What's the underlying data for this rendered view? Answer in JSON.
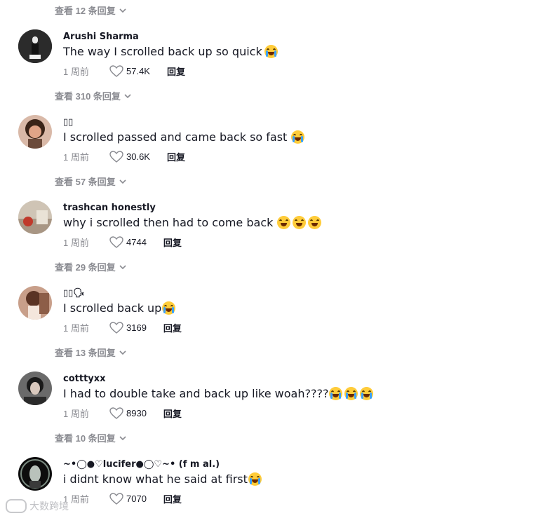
{
  "view_more": [
    {
      "label": "查看 12 条回复"
    },
    {
      "label": "查看 310 条回复"
    },
    {
      "label": "查看 57 条回复"
    },
    {
      "label": "查看 29 条回复"
    },
    {
      "label": "查看 13 条回复"
    },
    {
      "label": "查看 10 条回复"
    }
  ],
  "comments": [
    {
      "username": "Arushi Sharma",
      "text": "The way I scrolled back up so quick",
      "emoji": "crying-face",
      "time": "1 周前",
      "likes": "57.4K",
      "reply": "回复"
    },
    {
      "username": "▯▯",
      "text": "I scrolled passed and came back so fast",
      "emoji": "crying-face",
      "time": "1 周前",
      "likes": "30.6K",
      "reply": "回复"
    },
    {
      "username": "trashcan honestly",
      "text": "why i scrolled then had to come back",
      "emoji": "grinning-face x3",
      "time": "1 周前",
      "likes": "4744",
      "reply": "回复"
    },
    {
      "username": "▯▯🗣",
      "text": "I scrolled back up",
      "emoji": "crying-face",
      "time": "1 周前",
      "likes": "3169",
      "reply": "回复"
    },
    {
      "username": "cotttyxx",
      "text": "I had to double take and back up like woah????",
      "emoji": "crying-face x3",
      "time": "1 周前",
      "likes": "8930",
      "reply": "回复"
    },
    {
      "username": "~•◯●♡lucifer●◯♡~• (f m al.)",
      "text": "i didnt know what he said at first",
      "emoji": "crying-face",
      "time": "1 周前",
      "likes": "7070",
      "reply": "回复"
    }
  ],
  "watermark": {
    "text": "大数跨境"
  }
}
